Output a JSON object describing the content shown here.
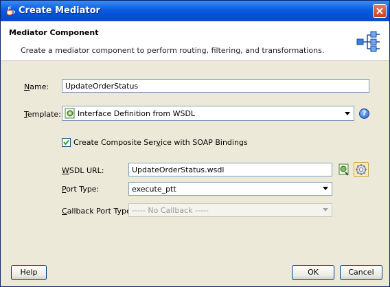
{
  "window": {
    "title": "Create Mediator"
  },
  "header": {
    "title": "Mediator Component",
    "description": "Create a mediator component to perform routing, filtering, and transformations."
  },
  "form": {
    "name": {
      "label_mnemonic": "N",
      "label_rest": "ame:",
      "value": "UpdateOrderStatus"
    },
    "template": {
      "label_mnemonic": "T",
      "label_rest": "emplate:",
      "value": "Interface Definition from WSDL"
    },
    "composite_checkbox": {
      "label_before": "Create Composite Ser",
      "label_mnemonic": "v",
      "label_after": "ice with SOAP Bindings",
      "checked": true
    },
    "wsdl_url": {
      "label_mnemonic": "W",
      "label_rest": "SDL URL:",
      "value": "UpdateOrderStatus.wsdl"
    },
    "port_type": {
      "label_before": "",
      "label_mnemonic": "P",
      "label_after": "ort Type:",
      "value": "execute_ptt"
    },
    "callback_port_type": {
      "label_mnemonic": "C",
      "label_rest": "allback Port Type:",
      "value": "----- No Callback -----",
      "enabled": false
    }
  },
  "buttons": {
    "help": "Help",
    "ok": "OK",
    "cancel": "Cancel"
  },
  "colors": {
    "titlebar": "#0a5ce0",
    "dialog_bg": "#ece9d8",
    "accent": "#7f9db9"
  }
}
